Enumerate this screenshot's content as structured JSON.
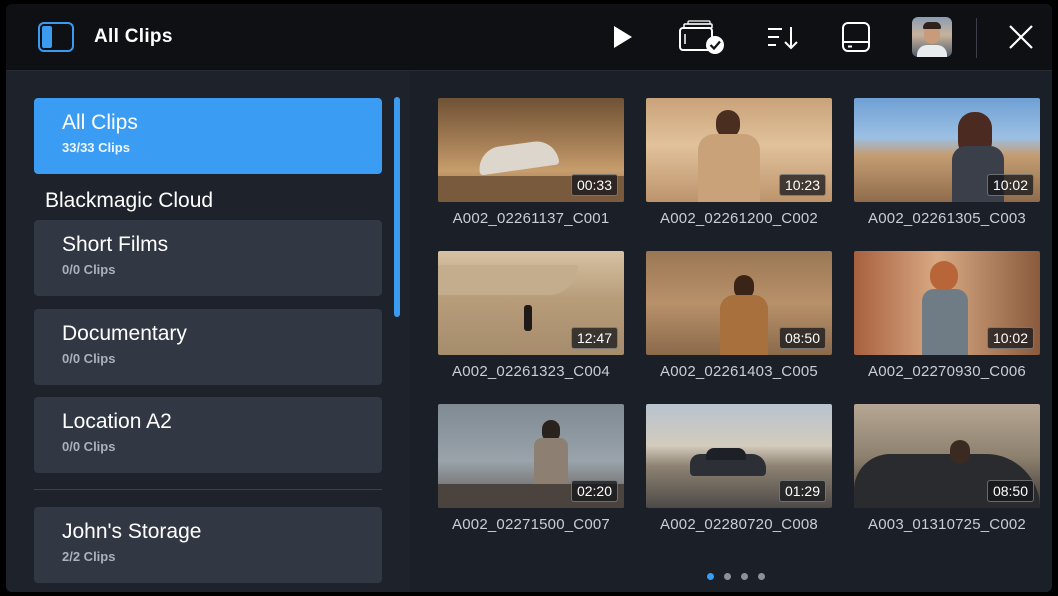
{
  "header": {
    "title": "All Clips",
    "icons": [
      "sidebar-toggle-icon",
      "play-icon",
      "card-check-icon",
      "sort-icon",
      "storage-drive-icon",
      "avatar",
      "close-icon"
    ]
  },
  "sidebar": {
    "items": [
      {
        "title": "All Clips",
        "subtitle": "33/33 Clips",
        "active": true
      },
      {
        "title": "Short Films",
        "subtitle": "0/0 Clips"
      },
      {
        "title": "Documentary",
        "subtitle": "0/0 Clips"
      },
      {
        "title": "Location A2",
        "subtitle": "0/0 Clips"
      },
      {
        "title": "John's Storage",
        "subtitle": "2/2 Clips"
      }
    ],
    "section_label": "Blackmagic Cloud"
  },
  "clips": [
    {
      "name": "A002_02261137_C001",
      "duration": "00:33"
    },
    {
      "name": "A002_02261200_C002",
      "duration": "10:23"
    },
    {
      "name": "A002_02261305_C003",
      "duration": "10:02"
    },
    {
      "name": "A002_02261323_C004",
      "duration": "12:47"
    },
    {
      "name": "A002_02261403_C005",
      "duration": "08:50"
    },
    {
      "name": "A002_02270930_C006",
      "duration": "10:02"
    },
    {
      "name": "A002_02271500_C007",
      "duration": "02:20"
    },
    {
      "name": "A002_02280720_C008",
      "duration": "01:29"
    },
    {
      "name": "A003_01310725_C002",
      "duration": "08:50"
    }
  ],
  "pagination": {
    "pages": 4,
    "current": 1
  },
  "colors": {
    "accent": "#3b9cf3",
    "card": "#313843",
    "background": "#1b1f27"
  }
}
